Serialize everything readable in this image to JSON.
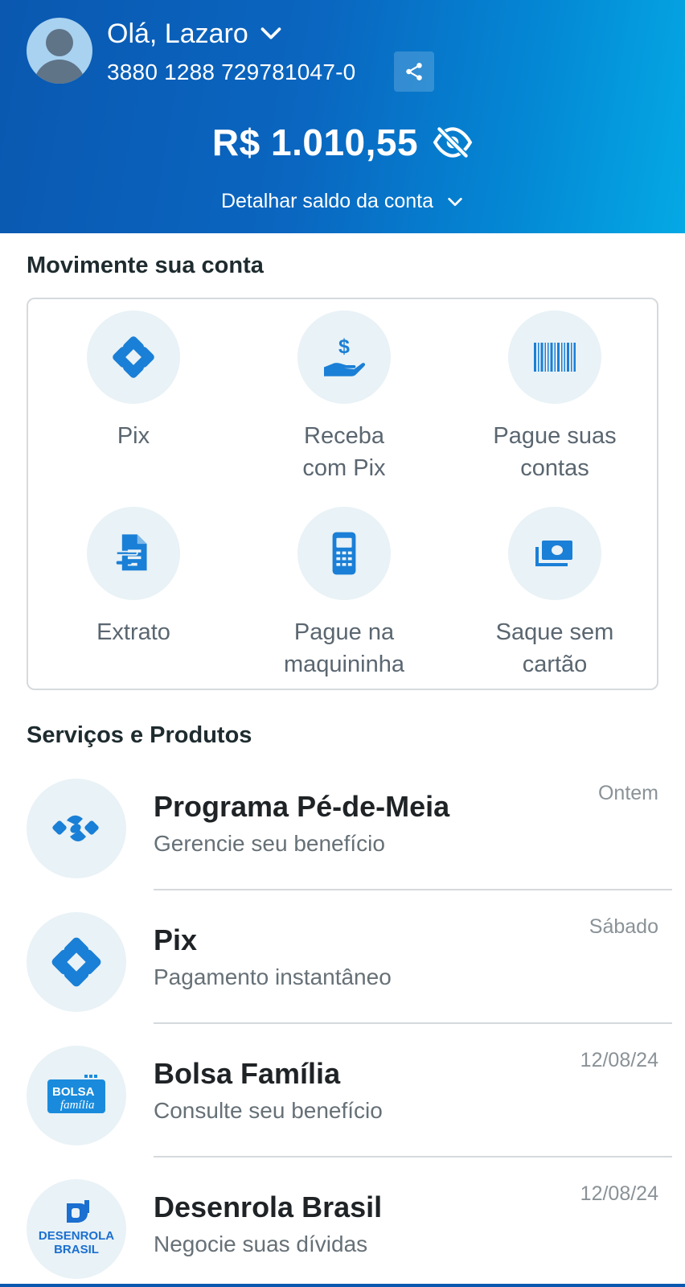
{
  "header": {
    "greeting": "Olá, Lazaro",
    "account_number": "3880 1288 729781047-0",
    "balance": "R$ 1.010,55",
    "detail_label": "Detalhar saldo da conta"
  },
  "movimente": {
    "title": "Movimente sua conta",
    "tiles": [
      {
        "label": "Pix",
        "icon": "pix-icon"
      },
      {
        "label": "Receba\ncom Pix",
        "icon": "receive-money-icon"
      },
      {
        "label": "Pague suas\ncontas",
        "icon": "barcode-icon"
      },
      {
        "label": "Extrato",
        "icon": "statement-icon"
      },
      {
        "label": "Pague na\nmaquininha",
        "icon": "card-machine-icon"
      },
      {
        "label": "Saque sem\ncartão",
        "icon": "cash-icon"
      }
    ]
  },
  "servicos": {
    "title": "Serviços e Produtos",
    "items": [
      {
        "title": "Programa Pé-de-Meia",
        "subtitle": "Gerencie seu benefício",
        "date": "Ontem",
        "icon": "pe-de-meia-icon"
      },
      {
        "title": "Pix",
        "subtitle": "Pagamento instantâneo",
        "date": "Sábado",
        "icon": "pix-icon"
      },
      {
        "title": "Bolsa Família",
        "subtitle": "Consulte seu benefício",
        "date": "12/08/24",
        "icon": "bolsa-familia-logo",
        "logo_text": [
          "BOLSA",
          "família"
        ]
      },
      {
        "title": "Desenrola Brasil",
        "subtitle": "Negocie suas dívidas",
        "date": "12/08/24",
        "icon": "desenrola-brasil-logo",
        "logo_text": [
          "DESENROLA",
          "BRASIL"
        ]
      }
    ]
  },
  "colors": {
    "header_start": "#0a58b0",
    "header_end": "#04a9e4",
    "accent": "#1a7fd6",
    "icon_bg": "#e9f2f6"
  }
}
